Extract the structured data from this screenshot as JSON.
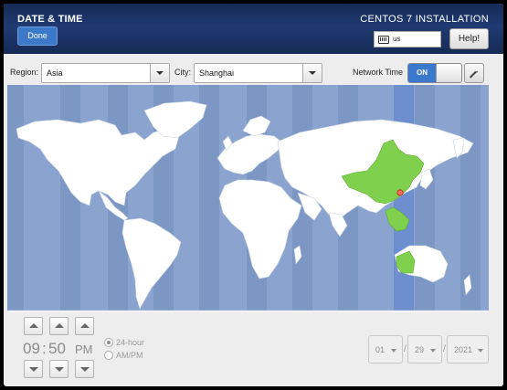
{
  "header": {
    "title": "DATE & TIME",
    "done_label": "Done",
    "install_title": "CENTOS 7 INSTALLATION",
    "keyboard_layout": "us",
    "help_label": "Help!"
  },
  "toolbar": {
    "region_label": "Region:",
    "region_value": "Asia",
    "city_label": "City:",
    "city_value": "Shanghai",
    "network_time_label": "Network Time",
    "network_time_state": "ON"
  },
  "map": {
    "ocean_color": "#8aa4cf",
    "land_color": "#ffffff",
    "selected_zone_color": "#7fd04c",
    "selected_band_color": "#6d8fd0",
    "marker_color": "#e33b2e"
  },
  "time": {
    "hour": "09",
    "separator": ":",
    "minute": "50",
    "ampm": "PM",
    "format_24": "24-hour",
    "format_ampm": "AM/PM",
    "selected_format": "24-hour"
  },
  "date": {
    "month": "01",
    "day": "29",
    "year": "2021",
    "separator": "/"
  },
  "icons": {
    "keyboard": "keyboard-icon",
    "gear": "gear-icon",
    "up": "chevron-up-icon",
    "down": "chevron-down-icon"
  }
}
